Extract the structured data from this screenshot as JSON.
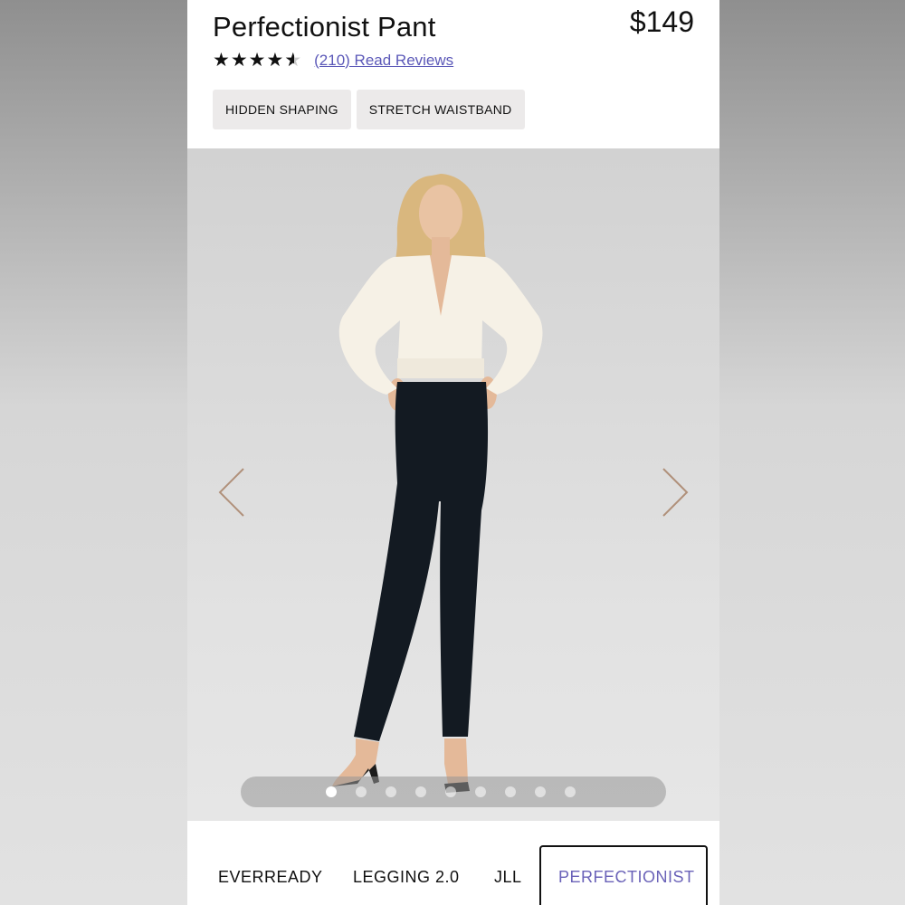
{
  "product": {
    "title": "Perfectionist Pant",
    "price": "$149",
    "rating_stars": 4.5,
    "reviews_link": "(210) Read Reviews"
  },
  "features": [
    "HIDDEN SHAPING",
    "STRETCH WAISTBAND"
  ],
  "gallery": {
    "image_count": 9,
    "active_index": 0
  },
  "tabs": [
    "EVERREADY",
    "LEGGING 2.0",
    "JLL",
    "PERFECTIONIST"
  ],
  "colors": {
    "link": "#5b58b8",
    "active_tab": "#6a62b8",
    "arrow": "#b0907a"
  }
}
